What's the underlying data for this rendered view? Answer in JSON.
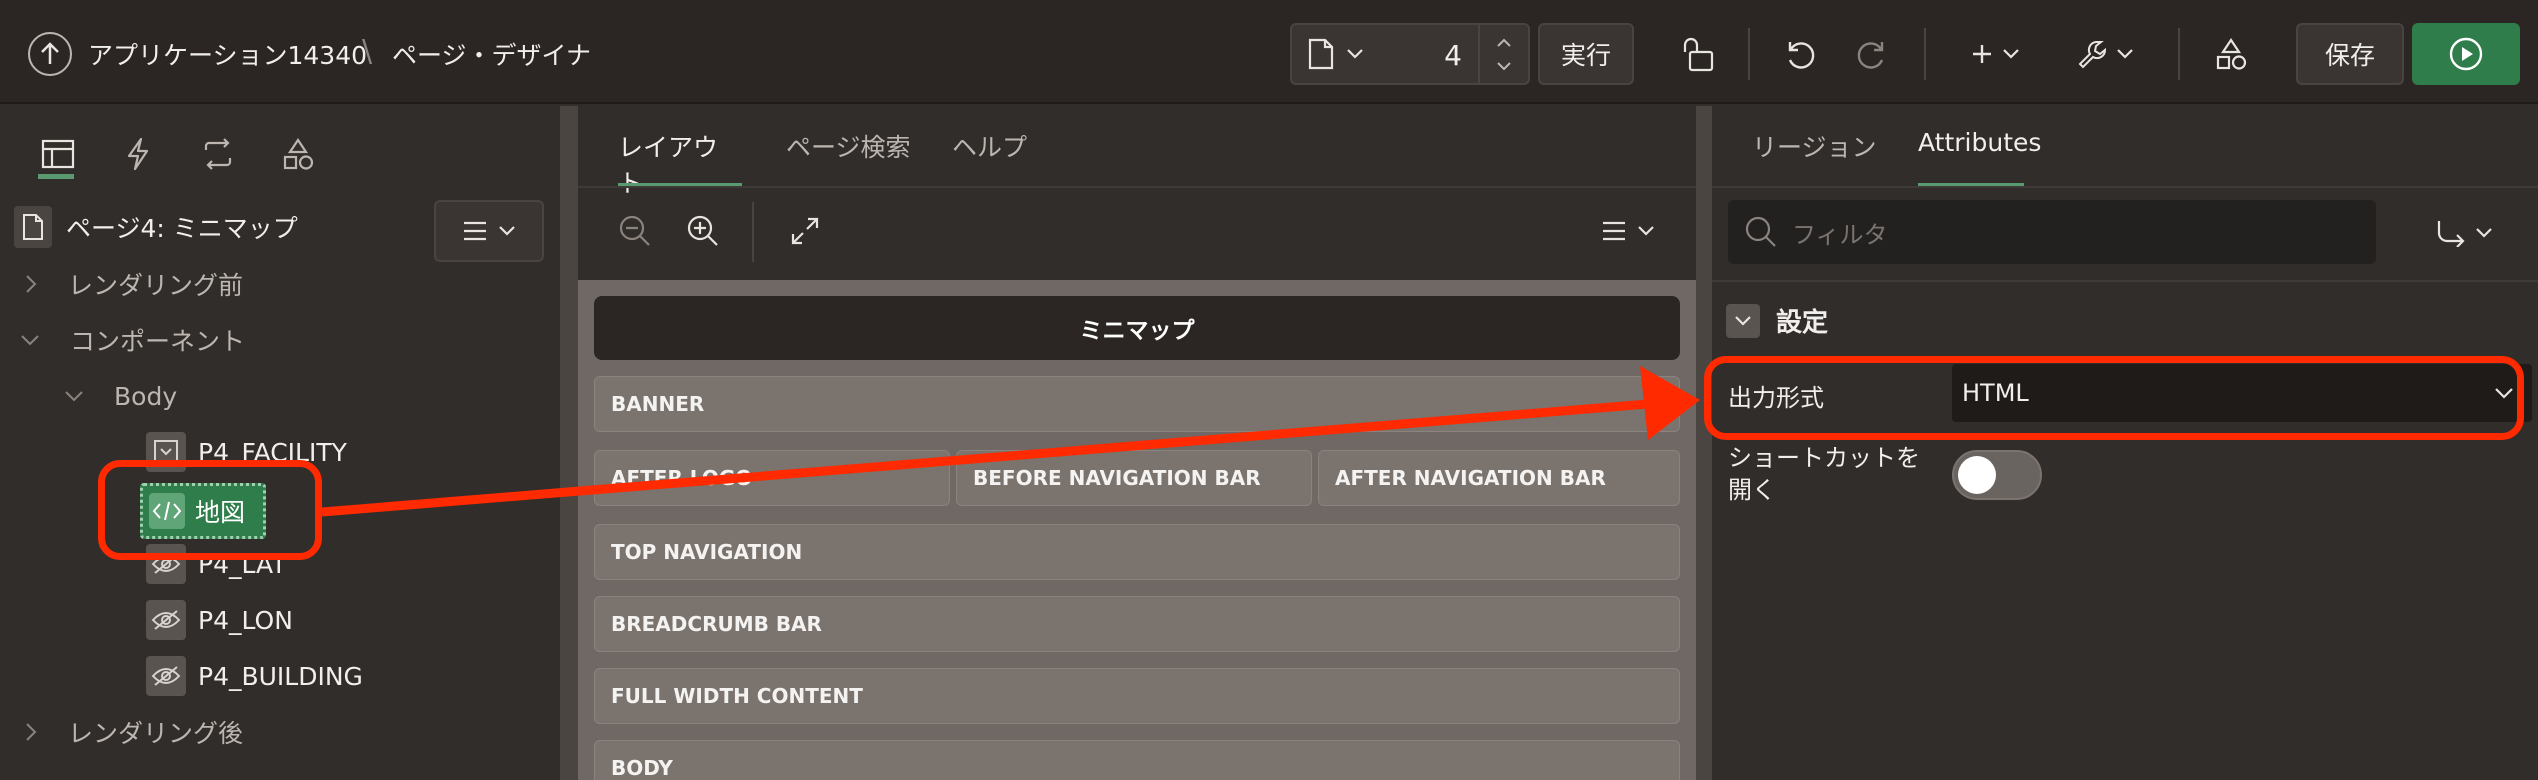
{
  "header": {
    "app_title": "アプリケーション14340",
    "separator": "\\",
    "page_designer": "ページ・デザイナ",
    "page_number": "4",
    "run_label": "実行",
    "save_label": "保存"
  },
  "left_panel": {
    "page_title": "ページ4: ミニマップ",
    "tree": {
      "before_rendering": "レンダリング前",
      "components": "コンポーネント",
      "body": "Body",
      "items": [
        "P4_FACILITY",
        "地図",
        "P4_LAT",
        "P4_LON",
        "P4_BUILDING"
      ],
      "after_rendering": "レンダリング後"
    }
  },
  "center_panel": {
    "tabs": [
      "レイアウト",
      "ページ検索",
      "ヘルプ"
    ],
    "region_title": "ミニマップ",
    "slots": {
      "banner": "BANNER",
      "after_logo": "AFTER LOGO",
      "before_nav": "BEFORE NAVIGATION BAR",
      "after_nav": "AFTER NAVIGATION BAR",
      "top_nav": "TOP NAVIGATION",
      "breadcrumb": "BREADCRUMB BAR",
      "full_width": "FULL WIDTH CONTENT",
      "body": "BODY"
    }
  },
  "right_panel": {
    "tabs": [
      "リージョン",
      "Attributes"
    ],
    "filter_placeholder": "フィルタ",
    "section_title": "設定",
    "output_format_label": "出力形式",
    "output_format_value": "HTML",
    "shortcut_label": "ショートカットを開く"
  },
  "colors": {
    "accent_green": "#5a9a70",
    "run_button": "#2f7d4a",
    "annotation_red": "#ff2a00"
  }
}
